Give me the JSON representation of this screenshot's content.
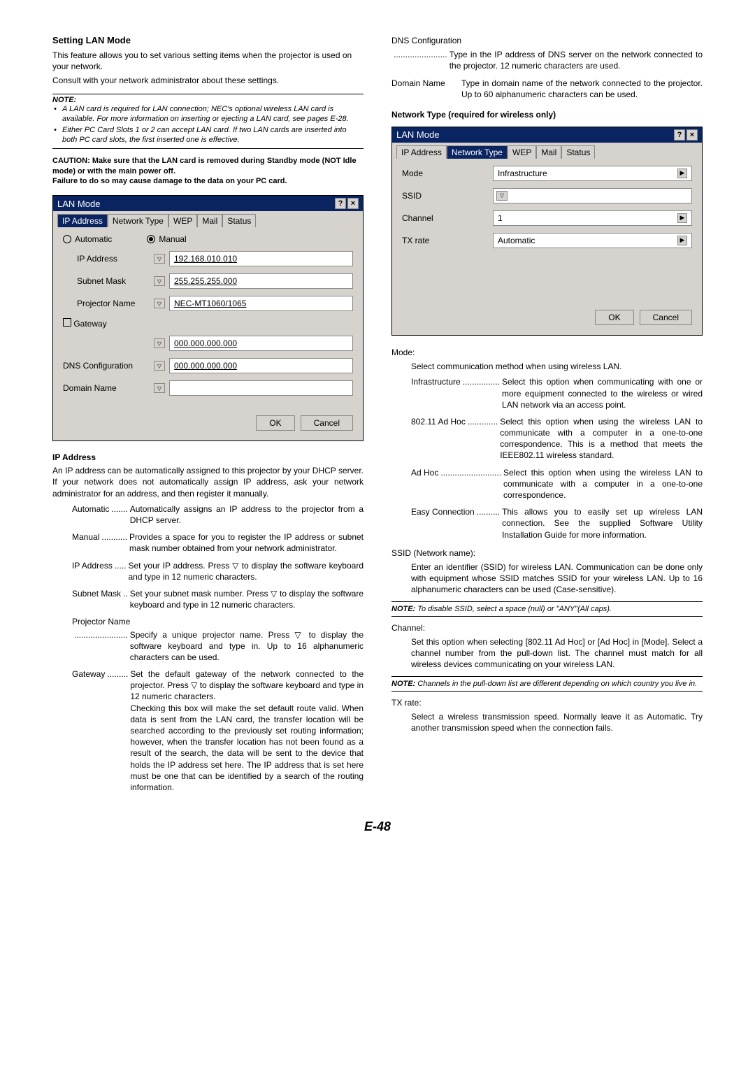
{
  "col1": {
    "heading": "Setting LAN Mode",
    "intro1": "This feature allows you to set various setting items when the projector is used on your network.",
    "intro2": "Consult with your network administrator about these settings.",
    "noteHeader": "NOTE:",
    "note1": "A LAN card is required for LAN connection; NEC's optional wireless LAN card is available. For more information on inserting or ejecting a LAN card, see pages E-28.",
    "note2": "Either PC Card Slots 1 or 2 can accept LAN card. If two LAN cards are inserted into both PC card slots, the first inserted one is effective.",
    "caution": "CAUTION: Make sure that the LAN card is removed during Standby mode (NOT Idle mode) or with the main power off.\nFailure to do so may cause damage to the data on your PC card.",
    "dlg1": {
      "title": "LAN Mode",
      "tabs": [
        "IP Address",
        "Network Type",
        "WEP",
        "Mail",
        "Status"
      ],
      "radioAuto": "Automatic",
      "radioManual": "Manual",
      "ipLabel": "IP Address",
      "ipVal": "192.168.010.010",
      "subnetLabel": "Subnet Mask",
      "subnetVal": "255.255.255.000",
      "projLabel": "Projector Name",
      "projVal": "NEC-MT1060/1065",
      "gatewayLabel": "Gateway",
      "gatewayVal": "000.000.000.000",
      "dnsLabel": "DNS Configuration",
      "dnsVal": "000.000.000.000",
      "domainLabel": "Domain Name",
      "ok": "OK",
      "cancel": "Cancel"
    },
    "ipHeading": "IP Address",
    "ipBody": "An IP address can be automatically assigned to this projector by your DHCP server. If your network does not automatically assign IP address, ask your network administrator for an address, and then register it manually.",
    "defAuto": "Automatic",
    "defAutoDots": ".......",
    "defAutoDesc": "Automatically assigns an IP address to the projector from a DHCP server.",
    "defManual": "Manual",
    "defManualDots": "...........",
    "defManualDesc": "Provides a space for you to register the IP address or subnet mask number obtained from your network administrator.",
    "defIp": "IP Address",
    "defIpDots": ".....",
    "defIpDesc": "Set your IP address. Press ▽ to display the software keyboard and type in 12 numeric characters.",
    "defSub": "Subnet Mask",
    "defSubDots": "..",
    "defSubDesc": "Set your subnet mask number. Press ▽ to display the software keyboard and type in 12 numeric characters.",
    "defProj": "Projector Name",
    "defProjDots": ".......................",
    "defProjDesc": "Specify a unique projector name. Press ▽ to display the software keyboard and type in. Up to 16 alphanumeric characters can be used.",
    "defGw": "Gateway",
    "defGwDots": ".........",
    "defGwDesc": "Set the default gateway of the network connected to the projector. Press ▽ to display the software keyboard and type in 12 numeric characters.\nChecking this box will make the set default route valid. When data is sent from the LAN card, the transfer location will be searched according to the previously set routing information; however, when the transfer location has not been found as a result of the search, the data will be sent to the device that holds the IP address set here. The IP address that is set here must be one that can be identified by a search of the routing information."
  },
  "col2": {
    "dnsHead": "DNS Configuration",
    "dnsDots": ".......................",
    "dnsDesc": "Type in the IP address of DNS server on the network connected to the projector. 12 numeric characters are used.",
    "domTerm": "Domain Name",
    "domDesc": "Type in domain name of the network connected to the projector. Up to 60 alphanumeric characters can be used.",
    "ntHeading": "Network Type (required for wireless only)",
    "dlg2": {
      "title": "LAN Mode",
      "tabs": [
        "IP Address",
        "Network Type",
        "WEP",
        "Mail",
        "Status"
      ],
      "modeLabel": "Mode",
      "modeVal": "Infrastructure",
      "ssidLabel": "SSID",
      "chLabel": "Channel",
      "chVal": "1",
      "txLabel": "TX rate",
      "txVal": "Automatic",
      "ok": "OK",
      "cancel": "Cancel"
    },
    "modeHead": "Mode:",
    "modeBody": "Select communication method when using wireless LAN.",
    "defInfra": "Infrastructure",
    "defInfraDots": "................",
    "defInfraDesc": "Select this option when communicating with one or more equipment connected to the wireless or wired LAN network via an access point.",
    "def802": "802.11 Ad Hoc",
    "def802Dots": ".............",
    "def802Desc": "Select this option when using the wireless LAN to communicate with a computer in a one-to-one correspondence. This is a method that meets the IEEE802.11 wireless standard.",
    "defAdHoc": "Ad Hoc",
    "defAdHocDots": "..........................",
    "defAdHocDesc": "Select this option when using the wireless LAN to communicate with a computer in a one-to-one correspondence.",
    "defEasy": "Easy Connection",
    "defEasyDots": "..........",
    "defEasyDesc": "This allows you to easily set up wireless LAN connection. See the supplied Software Utility Installation Guide for more information.",
    "ssidHead": "SSID (Network name):",
    "ssidBody": "Enter an identifier (SSID) for wireless LAN. Communication can be done only with equipment whose SSID matches SSID for your wireless LAN. Up to 16 alphanumeric characters can be used (Case-sensitive).",
    "ssidNoteP": "NOTE:",
    "ssidNote": " To disable SSID, select a space (null) or \"ANY\"(All caps).",
    "chHead": "Channel:",
    "chBody": "Set this option when selecting [802.11 Ad Hoc] or [Ad Hoc] in [Mode]. Select a channel number from the pull-down list. The channel must match for all wireless devices communicating on your wireless LAN.",
    "chNoteP": "NOTE:",
    "chNote": " Channels in the pull-down list are different depending on which country you live in.",
    "txHead": "TX rate:",
    "txBody": "Select a wireless transmission speed. Normally leave it as Automatic. Try another transmission speed when the connection fails."
  },
  "pageNum": "E-48"
}
